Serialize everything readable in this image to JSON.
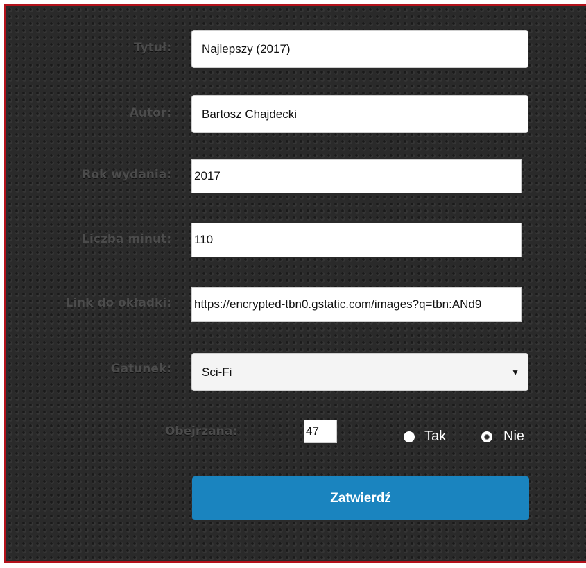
{
  "form": {
    "title": {
      "label": "Tytuł:",
      "value": "Najlepszy (2017)"
    },
    "author": {
      "label": "Autor:",
      "value": "Bartosz Chajdecki"
    },
    "year": {
      "label": "Rok wydania:",
      "value": "2017"
    },
    "minutes": {
      "label": "Liczba minut:",
      "value": "110"
    },
    "cover_link": {
      "label": "Link do okładki:",
      "value": "https://encrypted-tbn0.gstatic.com/images?q=tbn:ANd9"
    },
    "genre": {
      "label": "Gatunek:",
      "selected": "Sci-Fi"
    },
    "watched": {
      "label": "Obejrzana:",
      "count": "47",
      "options": [
        "Tak",
        "Nie"
      ],
      "selected": "Nie"
    },
    "submit_label": "Zatwierdź"
  },
  "colors": {
    "frame_border": "#b3121b",
    "background": "#2a2a2a",
    "label_text": "#4b4b4b",
    "submit_button": "#1a84bf"
  },
  "icons": {
    "select_arrow": "dropdown-arrow-icon"
  }
}
